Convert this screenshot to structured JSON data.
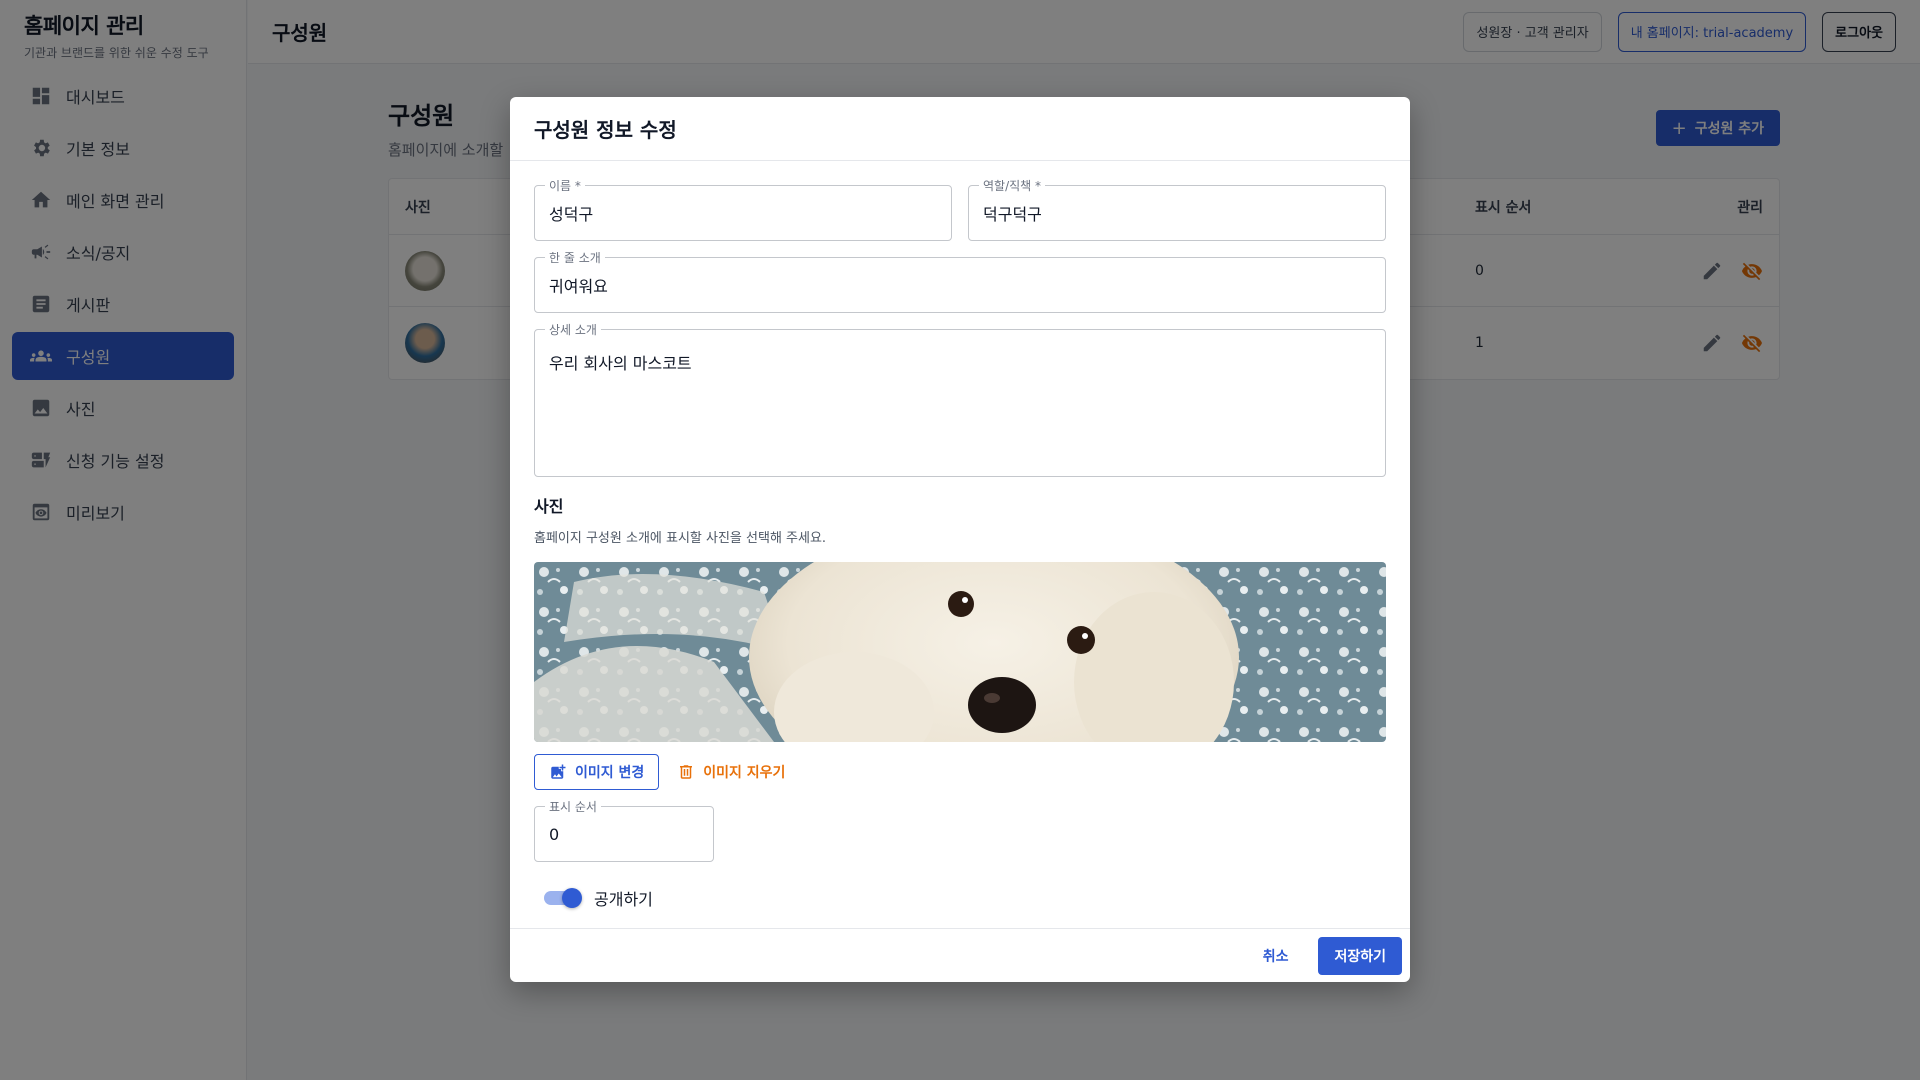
{
  "brand": {
    "title": "홈페이지 관리",
    "subtitle": "기관과 브랜드를 위한 쉬운 수정 도구"
  },
  "sidebar": {
    "items": [
      {
        "label": "대시보드",
        "icon": "dashboard-icon"
      },
      {
        "label": "기본 정보",
        "icon": "gear-icon"
      },
      {
        "label": "메인 화면 관리",
        "icon": "home-icon"
      },
      {
        "label": "소식/공지",
        "icon": "megaphone-icon"
      },
      {
        "label": "게시판",
        "icon": "article-icon"
      },
      {
        "label": "구성원",
        "icon": "people-icon",
        "active": true
      },
      {
        "label": "사진",
        "icon": "image-icon"
      },
      {
        "label": "신청 기능 설정",
        "icon": "dynamic-form-icon"
      },
      {
        "label": "미리보기",
        "icon": "preview-icon"
      }
    ]
  },
  "topbar": {
    "title": "구성원",
    "user_label": "성원장 · 고객 관리자",
    "home_label": "내 홈페이지: trial-academy",
    "logout_label": "로그아웃"
  },
  "main": {
    "title": "구성원",
    "subtitle": "홈페이지에 소개할",
    "add_button": "구성원 추가",
    "table": {
      "headers": {
        "photo": "사진",
        "order": "표시 순서",
        "manage": "관리"
      },
      "rows": [
        {
          "order": "0"
        },
        {
          "order": "1"
        }
      ]
    }
  },
  "dialog": {
    "title": "구성원 정보 수정",
    "name_label": "이름 *",
    "name_value": "성덕구",
    "role_label": "역할/직책 *",
    "role_value": "덕구덕구",
    "short_label": "한 줄 소개",
    "short_value": "귀여워요",
    "detail_label": "상세 소개",
    "detail_value": "우리 회사의 마스코트",
    "photo_section": "사진",
    "photo_desc": "홈페이지 구성원 소개에 표시할 사진을 선택해 주세요.",
    "change_image": "이미지 변경",
    "delete_image": "이미지 지우기",
    "order_label": "표시 순서",
    "order_value": "0",
    "public_label": "공개하기",
    "public_on": true,
    "cancel": "취소",
    "save": "저장하기"
  },
  "colors": {
    "primary": "#2f5bd3",
    "danger": "#e8710a",
    "overlay": "rgba(0,0,0,0.5)"
  }
}
